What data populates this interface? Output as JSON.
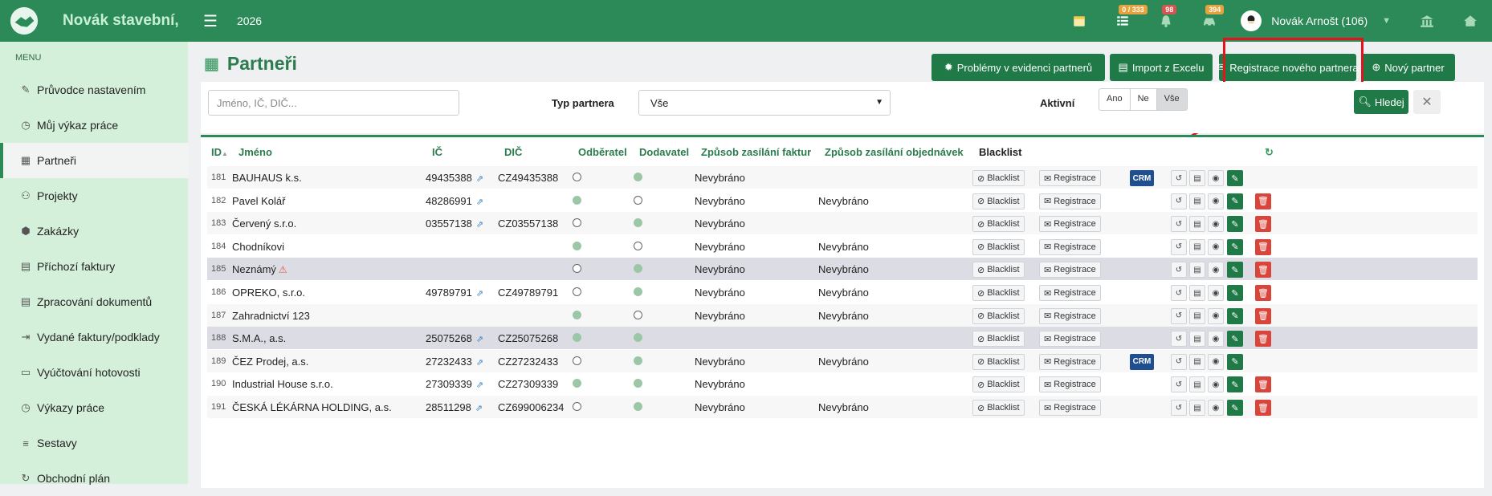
{
  "app": {
    "brand": "Novák stavební,",
    "year": "2026"
  },
  "topbar": {
    "badges": {
      "tasks": "0 / 333",
      "notifications": "98",
      "cars": "394"
    },
    "user": "Novák Arnošt (106)"
  },
  "sidebar": {
    "title": "MENU",
    "items": [
      {
        "label": "Průvodce nastavením",
        "icon": "pencil-icon"
      },
      {
        "label": "Můj výkaz práce",
        "icon": "clock-icon"
      },
      {
        "label": "Partneři",
        "icon": "building-icon",
        "active": true
      },
      {
        "label": "Projekty",
        "icon": "users-icon"
      },
      {
        "label": "Zakázky",
        "icon": "box-icon"
      },
      {
        "label": "Příchozí faktury",
        "icon": "document-icon"
      },
      {
        "label": "Zpracování dokumentů",
        "icon": "document-icon"
      },
      {
        "label": "Vydané faktury/podklady",
        "icon": "export-icon"
      },
      {
        "label": "Vyúčtování hotovosti",
        "icon": "money-icon"
      },
      {
        "label": "Výkazy práce",
        "icon": "clock-icon"
      },
      {
        "label": "Sestavy",
        "icon": "list-icon"
      },
      {
        "label": "Obchodní plán",
        "icon": "refresh-icon"
      }
    ]
  },
  "page": {
    "title": "Partneři",
    "buttons": {
      "problems": "Problémy v evidenci partnerů",
      "import": "Import z Excelu",
      "register": "Registrace nového partnera",
      "new": "Nový partner"
    }
  },
  "filters": {
    "search_placeholder": "Jméno, IČ, DIČ...",
    "type_label": "Typ partnera",
    "type_value": "Vše",
    "active_label": "Aktivní",
    "active_options": [
      "Ano",
      "Ne",
      "Vše"
    ],
    "active_selected": "Vše",
    "search_button": "Hledej"
  },
  "table": {
    "headers": {
      "id": "ID",
      "name": "Jméno",
      "ic": "IČ",
      "dic": "DIČ",
      "customer": "Odběratel",
      "supplier": "Dodavatel",
      "invoice_method": "Způsob zasílání faktur",
      "order_method": "Způsob zasílání objednávek",
      "blacklist": "Blacklist"
    },
    "labels": {
      "blacklist_btn": "Blacklist",
      "registrace_btn": "Registrace",
      "crm": "CRM"
    },
    "rows": [
      {
        "id": "181",
        "name": "BAUHAUS k.s.",
        "ic": "49435388",
        "dic": "CZ49435388",
        "customer": false,
        "supplier": true,
        "invoice": "Nevybráno",
        "order": "",
        "crm": true,
        "deletable": false,
        "highlight": false
      },
      {
        "id": "182",
        "name": "Pavel Kolář",
        "ic": "48286991",
        "dic": "",
        "customer": true,
        "supplier": false,
        "invoice": "Nevybráno",
        "order": "Nevybráno",
        "crm": false,
        "deletable": true,
        "highlight": false
      },
      {
        "id": "183",
        "name": "Červený s.r.o.",
        "ic": "03557138",
        "dic": "CZ03557138",
        "customer": false,
        "supplier": true,
        "invoice": "Nevybráno",
        "order": "",
        "crm": false,
        "deletable": true,
        "highlight": false
      },
      {
        "id": "184",
        "name": "Chodníkovi",
        "ic": "",
        "dic": "",
        "customer": true,
        "supplier": false,
        "invoice": "Nevybráno",
        "order": "Nevybráno",
        "crm": false,
        "deletable": true,
        "highlight": false
      },
      {
        "id": "185",
        "name": "Neznámý",
        "warn": true,
        "ic": "",
        "dic": "",
        "customer": false,
        "supplier": true,
        "invoice": "Nevybráno",
        "order": "Nevybráno",
        "crm": false,
        "deletable": true,
        "highlight": true
      },
      {
        "id": "186",
        "name": "OPREKO, s.r.o.",
        "ic": "49789791",
        "dic": "CZ49789791",
        "customer": false,
        "supplier": true,
        "invoice": "Nevybráno",
        "order": "Nevybráno",
        "crm": false,
        "deletable": true,
        "highlight": false
      },
      {
        "id": "187",
        "name": "Zahradnictví 123",
        "ic": "",
        "dic": "",
        "customer": true,
        "supplier": false,
        "invoice": "Nevybráno",
        "order": "Nevybráno",
        "crm": false,
        "deletable": true,
        "highlight": false
      },
      {
        "id": "188",
        "name": "S.M.A., a.s.",
        "ic": "25075268",
        "dic": "CZ25075268",
        "customer": true,
        "supplier": true,
        "invoice": "",
        "order": "",
        "crm": false,
        "deletable": true,
        "highlight": true
      },
      {
        "id": "189",
        "name": "ČEZ Prodej, a.s.",
        "ic": "27232433",
        "dic": "CZ27232433",
        "customer": false,
        "supplier": true,
        "invoice": "Nevybráno",
        "order": "Nevybráno",
        "crm": true,
        "deletable": false,
        "highlight": false
      },
      {
        "id": "190",
        "name": "Industrial House s.r.o.",
        "ic": "27309339",
        "dic": "CZ27309339",
        "customer": true,
        "supplier": true,
        "invoice": "Nevybráno",
        "order": "",
        "crm": false,
        "deletable": true,
        "highlight": false
      },
      {
        "id": "191",
        "name": "ČESKÁ LÉKÁRNA HOLDING, a.s.",
        "ic": "28511298",
        "dic": "CZ699006234",
        "customer": false,
        "supplier": true,
        "invoice": "Nevybráno",
        "order": "Nevybráno",
        "crm": false,
        "deletable": true,
        "highlight": false
      }
    ]
  },
  "colors": {
    "primary": "#2b8a57",
    "sidebar": "#d5f0da",
    "danger": "#d9453b",
    "crm": "#1f4f8f",
    "annotation": "#e3141c"
  }
}
